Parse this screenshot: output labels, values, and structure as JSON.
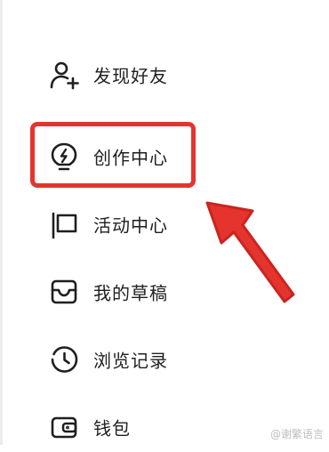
{
  "menu": {
    "items": [
      {
        "label": "发现好友",
        "icon": "add-user-icon"
      },
      {
        "label": "创作中心",
        "icon": "lightbulb-bolt-icon"
      },
      {
        "label": "活动中心",
        "icon": "flag-icon"
      },
      {
        "label": "我的草稿",
        "icon": "inbox-tray-icon"
      },
      {
        "label": "浏览记录",
        "icon": "history-clock-icon"
      },
      {
        "label": "钱包",
        "icon": "wallet-icon"
      }
    ]
  },
  "annotation": {
    "highlight_color": "#e5332e",
    "highlighted_item": "创作中心",
    "arrow_color": "#e5332e"
  },
  "watermark": {
    "text": "@谢繁语言"
  }
}
